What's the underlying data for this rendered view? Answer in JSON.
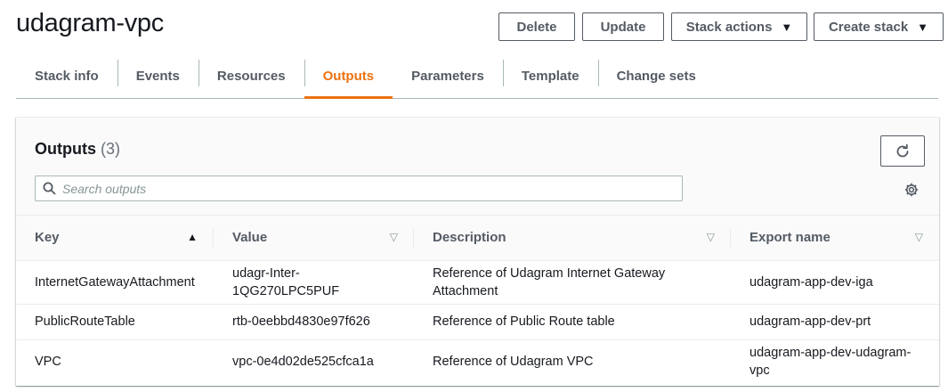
{
  "page": {
    "title": "udagram-vpc"
  },
  "actions": {
    "delete_label": "Delete",
    "update_label": "Update",
    "stack_actions_label": "Stack actions",
    "create_stack_label": "Create stack"
  },
  "tabs": [
    {
      "label": "Stack info",
      "active": false
    },
    {
      "label": "Events",
      "active": false
    },
    {
      "label": "Resources",
      "active": false
    },
    {
      "label": "Outputs",
      "active": true
    },
    {
      "label": "Parameters",
      "active": false
    },
    {
      "label": "Template",
      "active": false
    },
    {
      "label": "Change sets",
      "active": false
    }
  ],
  "outputs": {
    "title": "Outputs",
    "count": "(3)",
    "search": {
      "placeholder": "Search outputs",
      "value": ""
    },
    "columns": {
      "key": "Key",
      "value": "Value",
      "description": "Description",
      "export_name": "Export name"
    },
    "sort": {
      "column": "key",
      "direction": "ascending"
    },
    "rows": [
      {
        "key": "InternetGatewayAttachment",
        "value": "udagr-Inter-1QG270LPC5PUF",
        "description": "Reference of Udagram Internet Gateway Attachment",
        "export_name": "udagram-app-dev-iga"
      },
      {
        "key": "PublicRouteTable",
        "value": "rtb-0eebbd4830e97f626",
        "description": "Reference of Public Route table",
        "export_name": "udagram-app-dev-prt"
      },
      {
        "key": "VPC",
        "value": "vpc-0e4d02de525cfca1a",
        "description": "Reference of Udagram VPC",
        "export_name": "udagram-app-dev-udagram-vpc"
      }
    ]
  },
  "colors": {
    "accent": "#ec7211",
    "text": "#16191f",
    "muted": "#545b64",
    "border": "#aab7b8"
  },
  "icons": {
    "search": "search-icon",
    "refresh": "refresh-icon",
    "settings": "gear-icon",
    "caret": "caret-down-icon",
    "sort_asc": "sort-ascending-icon",
    "sort_none": "sort-unsorted-icon"
  }
}
